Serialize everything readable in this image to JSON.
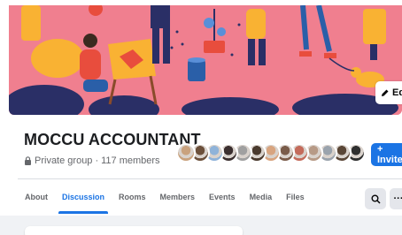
{
  "group": {
    "name": "MOCCU ACCOUNTANT",
    "privacy": "Private group",
    "separator": "·",
    "members": "117 members"
  },
  "cover": {
    "edit_label": "Edit",
    "colors": {
      "background": "#f07f8f",
      "accent_yellow": "#f9b233",
      "accent_blue": "#2a5fa8"
    }
  },
  "actions": {
    "invite_label": "+ Invite",
    "search_icon": "search-icon",
    "more_label": "···"
  },
  "tabs": [
    {
      "label": "About",
      "active": false
    },
    {
      "label": "Discussion",
      "active": true
    },
    {
      "label": "Rooms",
      "active": false
    },
    {
      "label": "Members",
      "active": false
    },
    {
      "label": "Events",
      "active": false
    },
    {
      "label": "Media",
      "active": false
    },
    {
      "label": "Files",
      "active": false
    }
  ],
  "member_avatars": [
    {
      "name": "member-avatar-1",
      "color": "#c9a27e"
    },
    {
      "name": "member-avatar-2",
      "color": "#6b4f3a"
    },
    {
      "name": "member-avatar-3",
      "color": "#8fb3d9"
    },
    {
      "name": "member-avatar-4",
      "color": "#3b2f2f"
    },
    {
      "name": "member-avatar-5",
      "color": "#a0a0a0"
    },
    {
      "name": "member-avatar-6",
      "color": "#4a3a2e"
    },
    {
      "name": "member-avatar-7",
      "color": "#d8a47f"
    },
    {
      "name": "member-avatar-8",
      "color": "#7a5c4a"
    },
    {
      "name": "member-avatar-9",
      "color": "#c46b5b"
    },
    {
      "name": "member-avatar-10",
      "color": "#b79a86"
    },
    {
      "name": "member-avatar-11",
      "color": "#9aa3ad"
    },
    {
      "name": "member-avatar-12",
      "color": "#5a4636"
    },
    {
      "name": "member-avatar-13",
      "color": "#2f2f2f"
    }
  ],
  "colors": {
    "brand_blue": "#1b74e4",
    "text_primary": "#1c1e21",
    "text_secondary": "#65676b"
  }
}
